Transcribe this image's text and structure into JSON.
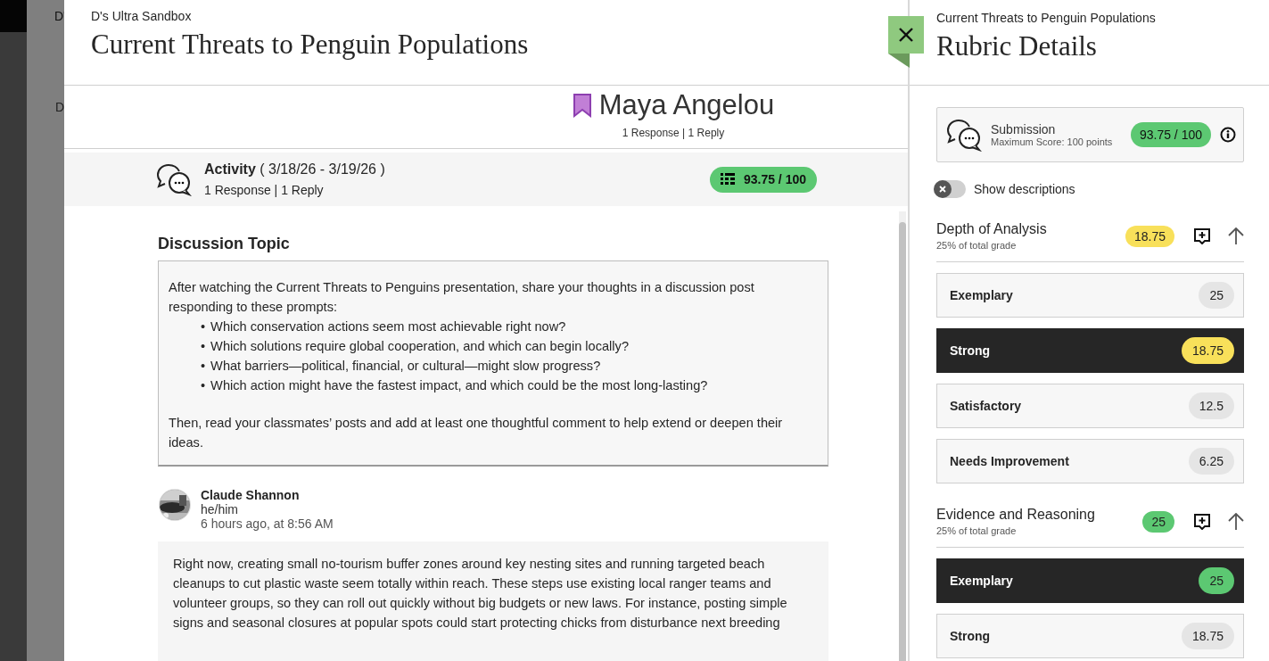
{
  "backdrop": {
    "course": "D'",
    "tab": "D"
  },
  "main": {
    "course": "D's Ultra Sandbox",
    "title": "Current Threats to Penguin Populations"
  },
  "student": {
    "name": "Maya Angelou",
    "flagged": true,
    "counts": "1 Response | 1 Reply"
  },
  "activity": {
    "label": "Activity",
    "dates": "( 3/18/26 - 3/19/26 )",
    "counts": "1 Response | 1 Reply",
    "grade": "93.75 / 100"
  },
  "topic": {
    "heading": "Discussion Topic",
    "intro": "After watching the Current Threats to Penguins presentation, share your thoughts in a discussion post responding to these prompts:",
    "marker": "•",
    "bullets": [
      "Which conservation actions seem most achievable right now?",
      "Which solutions require global cooperation, and which can begin locally?",
      "What barriers—political, financial, or cultural—might slow progress?",
      "Which action might have the fastest impact, and which could be the most long-lasting?"
    ],
    "closing": "Then, read your classmates’ posts and add at least one thoughtful comment to help extend or deepen their ideas."
  },
  "post": {
    "author": "Claude Shannon",
    "pronouns": "he/him",
    "time": "6 hours ago, at 8:56 AM",
    "body": "Right now, creating small no-tourism buffer zones around key nesting sites and running targeted beach cleanups to cut plastic waste seem totally within reach. These steps use existing local ranger teams and volunteer groups, so they can roll out quickly without big budgets or new laws. For instance, posting simple signs and seasonal closures at popular spots could start protecting chicks from disturbance next breeding"
  },
  "rubric": {
    "context": "Current Threats to Penguin Populations",
    "title": "Rubric Details",
    "submission": {
      "label": "Submission",
      "max": "Maximum Score: 100 points",
      "score": "93.75 / 100"
    },
    "show_descriptions": {
      "label": "Show descriptions",
      "on": false
    },
    "criteria": [
      {
        "name": "Depth of Analysis",
        "weight": "25% of total grade",
        "score": "18.75",
        "color": "#f8e05a",
        "expanded": true,
        "levels": [
          {
            "name": "Exemplary",
            "points": "25",
            "selected": false
          },
          {
            "name": "Strong",
            "points": "18.75",
            "selected": true
          },
          {
            "name": "Satisfactory",
            "points": "12.5",
            "selected": false
          },
          {
            "name": "Needs Improvement",
            "points": "6.25",
            "selected": false
          }
        ]
      },
      {
        "name": "Evidence and Reasoning",
        "weight": "25% of total grade",
        "score": "25",
        "color": "#5cc872",
        "expanded": true,
        "levels": [
          {
            "name": "Exemplary",
            "points": "25",
            "selected": true
          },
          {
            "name": "Strong",
            "points": "18.75",
            "selected": false
          }
        ]
      }
    ]
  }
}
